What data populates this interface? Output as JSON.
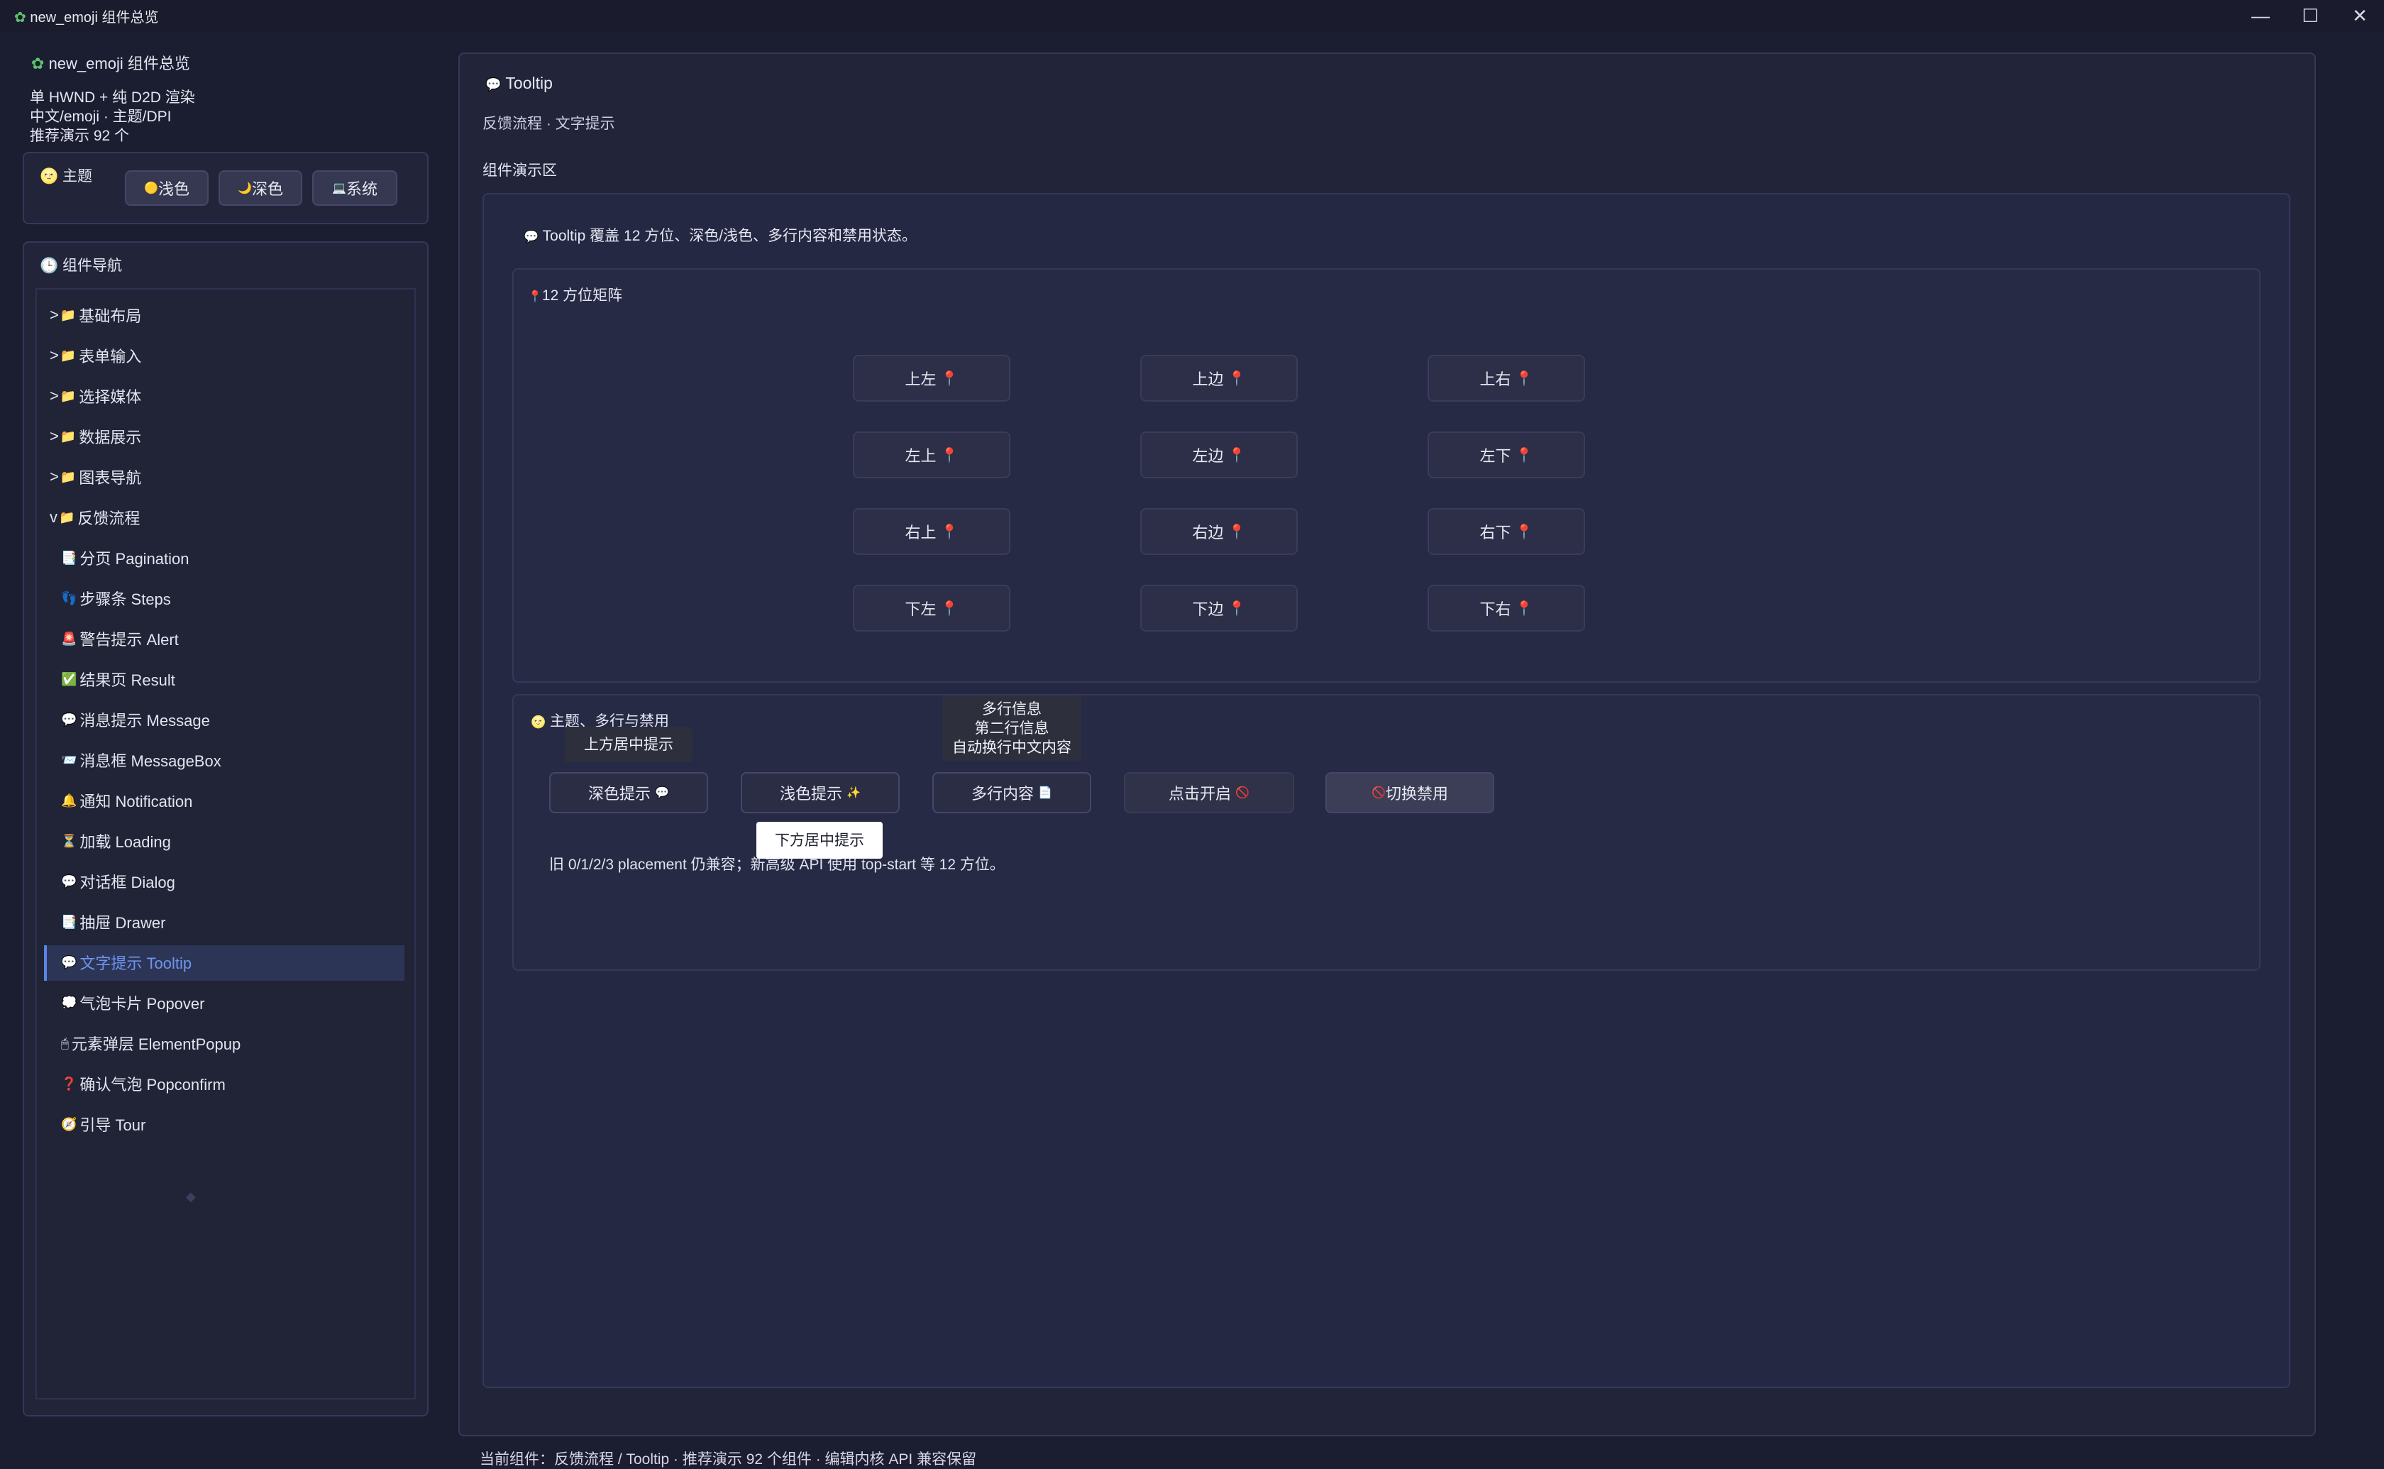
{
  "window": {
    "title": "new_emoji 组件总览",
    "minimize": "—",
    "maximize": "☐",
    "close": "✕"
  },
  "sidebar": {
    "app_title": "new_emoji 组件总览",
    "info_lines": [
      "单 HWND + 纯 D2D 渲染",
      "中文/emoji · 主题/DPI",
      "推荐演示 92 个"
    ],
    "theme": {
      "title": "主题",
      "buttons": [
        {
          "icon": "🟡",
          "label": "浅色"
        },
        {
          "icon": "🌙",
          "label": "深色"
        },
        {
          "icon": "💻",
          "label": "系统"
        }
      ]
    },
    "nav": {
      "title": "组件导航",
      "items": [
        {
          "prefix": ">",
          "icon": "📁",
          "label": "基础布局"
        },
        {
          "prefix": ">",
          "icon": "📁",
          "label": "表单输入"
        },
        {
          "prefix": ">",
          "icon": "📁",
          "label": "选择媒体"
        },
        {
          "prefix": ">",
          "icon": "📁",
          "label": "数据展示"
        },
        {
          "prefix": ">",
          "icon": "📁",
          "label": "图表导航"
        },
        {
          "prefix": "v",
          "icon": "📁",
          "label": "反馈流程"
        },
        {
          "prefix": "",
          "icon": "📑",
          "label": "分页 Pagination"
        },
        {
          "prefix": "",
          "icon": "👣",
          "label": "步骤条 Steps"
        },
        {
          "prefix": "",
          "icon": "🚨",
          "label": "警告提示 Alert"
        },
        {
          "prefix": "",
          "icon": "✅",
          "label": "结果页 Result"
        },
        {
          "prefix": "",
          "icon": "💬",
          "label": "消息提示 Message"
        },
        {
          "prefix": "",
          "icon": "📨",
          "label": "消息框 MessageBox"
        },
        {
          "prefix": "",
          "icon": "🔔",
          "label": "通知 Notification"
        },
        {
          "prefix": "",
          "icon": "⏳",
          "label": "加载 Loading"
        },
        {
          "prefix": "",
          "icon": "💬",
          "label": "对话框 Dialog"
        },
        {
          "prefix": "",
          "icon": "📑",
          "label": "抽屉 Drawer"
        },
        {
          "prefix": "",
          "icon": "💬",
          "label": "文字提示 Tooltip"
        },
        {
          "prefix": "",
          "icon": "💭",
          "label": "气泡卡片 Popover"
        },
        {
          "prefix": "",
          "icon": "🖱",
          "label": "元素弹层 ElementPopup"
        },
        {
          "prefix": "",
          "icon": "❓",
          "label": "确认气泡 Popconfirm"
        },
        {
          "prefix": "",
          "icon": "🧭",
          "label": "引导 Tour"
        }
      ]
    }
  },
  "main": {
    "header_icon": "💬",
    "title": "Tooltip",
    "subtitle": "反馈流程 · 文字提示",
    "demo_label": "组件演示区",
    "intro_icon": "💬",
    "intro": "Tooltip 覆盖 12 方位、深色/浅色、多行内容和禁用状态。",
    "matrix": {
      "icon": "📍",
      "title": "12 方位矩阵",
      "pin": "📍",
      "buttons": [
        "上左",
        "上边",
        "上右",
        "左上",
        "左边",
        "左下",
        "右上",
        "右边",
        "右下",
        "下左",
        "下边",
        "下右"
      ]
    },
    "theme_section": {
      "icon": "🌝",
      "title": "主题、多行与禁用",
      "buttons": [
        {
          "label": "深色提示",
          "icon": "💬"
        },
        {
          "label": "浅色提示",
          "icon": "✨"
        },
        {
          "label": "多行内容",
          "icon": "📄"
        },
        {
          "label": "点击开启",
          "icon": "🚫"
        },
        {
          "label": "切换禁用",
          "icon": "🚫"
        }
      ],
      "tooltip_top": "上方居中提示",
      "tooltip_multiline": [
        "多行信息",
        "第二行信息",
        "自动换行中文内容"
      ],
      "tooltip_bottom": "下方居中提示",
      "note": "旧 0/1/2/3 placement 仍兼容；新高级 API 使用 top-start 等 12 方位。"
    },
    "status_bar": "当前组件：反馈流程 / Tooltip · 推荐演示 92 个组件 · 编辑内核 API 兼容保留"
  }
}
